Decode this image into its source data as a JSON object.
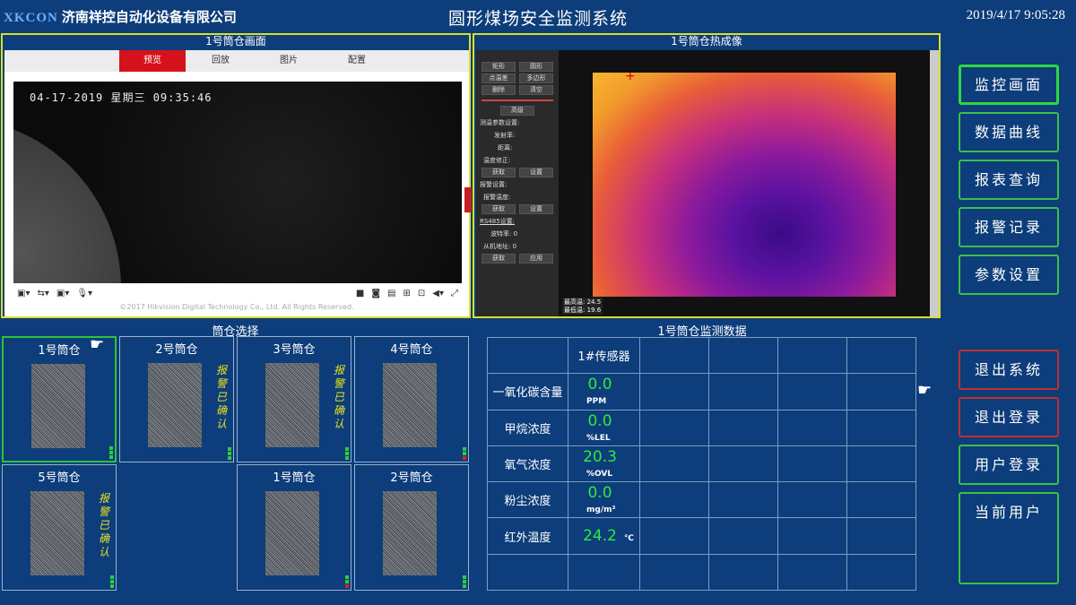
{
  "header": {
    "brand": "XKCON",
    "company": "济南祥控自动化设备有限公司",
    "title": "圆形煤场安全监测系统",
    "datetime": "2019/4/17  9:05:28"
  },
  "camera": {
    "title": "1号筒仓画面",
    "tabs": [
      "预览",
      "回放",
      "图片",
      "配置"
    ],
    "active_tab": "预览",
    "osd": "04-17-2019 星期三 09:35:46",
    "copyright": "©2017 Hikvision Digital Technology Co., Ltd. All Rights Reserved."
  },
  "thermal": {
    "title": "1号筒仓热成像",
    "buttons": [
      "矩形",
      "圆形",
      "点温差",
      "多边形",
      "删除",
      "清空"
    ],
    "advanced": "高级",
    "measure_label": "测温参数设置:",
    "emissivity": "发射率:",
    "distance": "距离:",
    "temp_correction": "温度修正:",
    "get": "获取",
    "set": "设置",
    "alarm_label": "报警设置:",
    "alarm_temp": "报警温度:",
    "rs485_label": "RS485设置:",
    "baud": "波特率:",
    "baud_val": "0",
    "slave": "从机地址:",
    "slave_val": "0",
    "apply": "应用",
    "max_temp": "最高温: 24.5",
    "min_temp": "最低温: 19.6"
  },
  "menu": {
    "monitor": "监控画面",
    "curve": "数据曲线",
    "report": "报表查询",
    "alarm": "报警记录",
    "params": "参数设置",
    "exit_system": "退出系统",
    "logout": "退出登录",
    "login": "用户登录",
    "current_user": "当前用户"
  },
  "bins_title": "筒仓选择",
  "bins": [
    {
      "name": "1号筒仓",
      "alarm": ""
    },
    {
      "name": "2号筒仓",
      "alarm": "报警已确认"
    },
    {
      "name": "3号筒仓",
      "alarm": "报警已确认"
    },
    {
      "name": "4号筒仓",
      "alarm": ""
    },
    {
      "name": "5号筒仓",
      "alarm": "报警已确认"
    },
    {
      "name": "1号筒仓",
      "alarm": ""
    },
    {
      "name": "2号筒仓",
      "alarm": ""
    }
  ],
  "monitor_data": {
    "title": "1号筒仓监测数据",
    "sensor_header": "1#传感器",
    "rows": [
      {
        "label": "一氧化碳含量",
        "value": "0.0",
        "unit": "PPM"
      },
      {
        "label": "甲烷浓度",
        "value": "0.0",
        "unit": "%LEL"
      },
      {
        "label": "氧气浓度",
        "value": "20.3",
        "unit": "%OVL"
      },
      {
        "label": "粉尘浓度",
        "value": "0.0",
        "unit": "mg/m³"
      },
      {
        "label": "红外温度",
        "value": "24.2",
        "unit": "℃"
      }
    ]
  },
  "colors": {
    "background": "#0d3d7a",
    "panel_border": "#d8e02a",
    "value_green": "#2cea3c",
    "menu_green": "#3ac04a",
    "menu_red": "#c23030"
  }
}
